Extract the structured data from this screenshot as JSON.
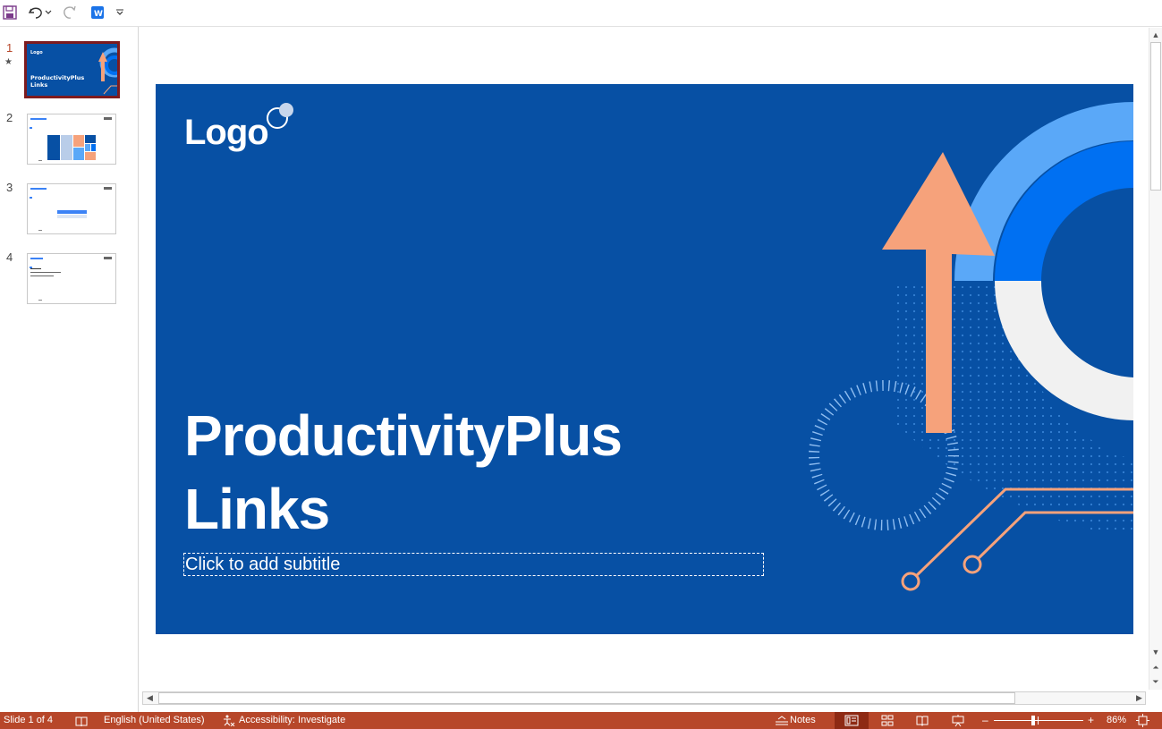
{
  "quick_access": {
    "icons": [
      "save-icon",
      "undo-icon",
      "undo-dropdown-icon",
      "redo-icon",
      "app-addin-icon",
      "customize-dropdown-icon"
    ]
  },
  "thumbnails": [
    {
      "number": "1",
      "selected": true,
      "has_animation": true
    },
    {
      "number": "2",
      "selected": false
    },
    {
      "number": "3",
      "selected": false
    },
    {
      "number": "4",
      "selected": false
    }
  ],
  "slide": {
    "logo": "Logo",
    "title_line1": "ProductivityPlus",
    "title_line2": "Links",
    "subtitle_placeholder": "Click to add subtitle",
    "colors": {
      "background": "#0750a4",
      "arc_light": "#5aa8f8",
      "arc_mid": "#0070f2",
      "arc_white": "#f1f1f1",
      "arrow": "#f6a27b",
      "circuit": "#f6a27b"
    }
  },
  "statusbar": {
    "slide_counter": "Slide 1 of 4",
    "language": "English (United States)",
    "accessibility": "Accessibility: Investigate",
    "notes": "Notes",
    "zoom": "86%",
    "zoom_minus": "–",
    "zoom_plus": "+",
    "color": "#b7472a"
  }
}
